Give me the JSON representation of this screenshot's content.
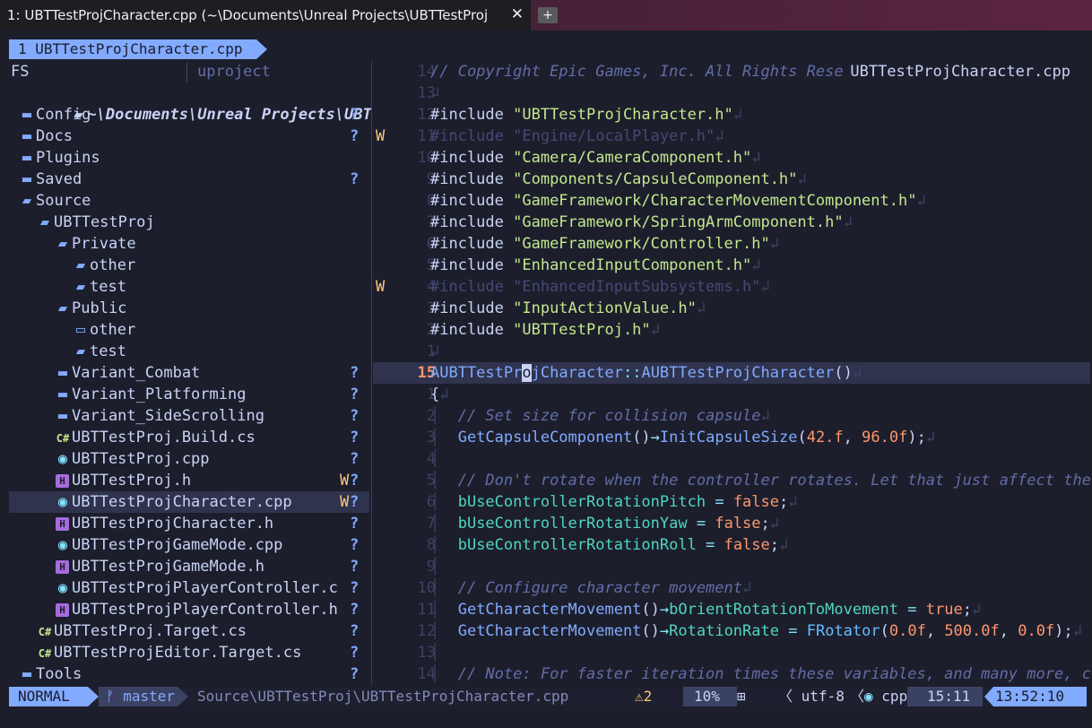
{
  "terminal": {
    "tab_title": "1: UBTTestProjCharacter.cpp (~\\Documents\\Unreal Projects\\UBTTestProj",
    "close_glyph": "✕",
    "new_tab_glyph": "+"
  },
  "bufferline": {
    "tab_label": "1 UBTTestProjCharacter.cpp"
  },
  "sidebar": {
    "header_left": "FS",
    "header_right": "uproject",
    "root": "~\\Documents\\Unreal Projects\\UBTTestPr",
    "items": [
      {
        "label": "Config",
        "icon": "folder-closed-icon",
        "glyph": "▬",
        "indent": 1,
        "git": "?",
        "warn": ""
      },
      {
        "label": "Docs",
        "icon": "folder-closed-icon",
        "glyph": "▬",
        "indent": 1,
        "git": "?",
        "warn": ""
      },
      {
        "label": "Plugins",
        "icon": "folder-closed-icon",
        "glyph": "▬",
        "indent": 1,
        "git": "",
        "warn": ""
      },
      {
        "label": "Saved",
        "icon": "folder-closed-icon",
        "glyph": "▬",
        "indent": 1,
        "git": "?",
        "warn": ""
      },
      {
        "label": "Source",
        "icon": "folder-open-icon",
        "glyph": "▰",
        "indent": 1,
        "git": "",
        "warn": ""
      },
      {
        "label": "UBTTestProj",
        "icon": "folder-open-icon",
        "glyph": "▰",
        "indent": 2,
        "git": "",
        "warn": ""
      },
      {
        "label": "Private",
        "icon": "folder-open-icon",
        "glyph": "▰",
        "indent": 3,
        "git": "",
        "warn": ""
      },
      {
        "label": "other",
        "icon": "folder-open-icon",
        "glyph": "▰",
        "indent": 4,
        "git": "",
        "warn": ""
      },
      {
        "label": "test",
        "icon": "folder-open-icon",
        "glyph": "▰",
        "indent": 4,
        "git": "",
        "warn": ""
      },
      {
        "label": "Public",
        "icon": "folder-open-icon",
        "glyph": "▰",
        "indent": 3,
        "git": "",
        "warn": ""
      },
      {
        "label": "other",
        "icon": "folder-empty-icon",
        "glyph": "▭",
        "indent": 4,
        "git": "",
        "warn": ""
      },
      {
        "label": "test",
        "icon": "folder-open-icon",
        "glyph": "▰",
        "indent": 4,
        "git": "",
        "warn": ""
      },
      {
        "label": "Variant_Combat",
        "icon": "folder-closed-icon",
        "glyph": "▬",
        "indent": 3,
        "git": "?",
        "warn": ""
      },
      {
        "label": "Variant_Platforming",
        "icon": "folder-closed-icon",
        "glyph": "▬",
        "indent": 3,
        "git": "?",
        "warn": ""
      },
      {
        "label": "Variant_SideScrolling",
        "icon": "folder-closed-icon",
        "glyph": "▬",
        "indent": 3,
        "git": "?",
        "warn": ""
      },
      {
        "label": "UBTTestProj.Build.cs",
        "icon": "csharp-file-icon",
        "glyph": "C#",
        "indent": 3,
        "git": "?",
        "warn": ""
      },
      {
        "label": "UBTTestProj.cpp",
        "icon": "cpp-file-icon",
        "glyph": "◉",
        "indent": 3,
        "git": "?",
        "warn": ""
      },
      {
        "label": "UBTTestProj.h",
        "icon": "header-file-icon",
        "glyph": "H",
        "indent": 3,
        "git": "?",
        "warn": "W"
      },
      {
        "label": "UBTTestProjCharacter.cpp",
        "icon": "cpp-file-icon",
        "glyph": "◉",
        "indent": 3,
        "git": "?",
        "warn": "W",
        "selected": true
      },
      {
        "label": "UBTTestProjCharacter.h",
        "icon": "header-file-icon",
        "glyph": "H",
        "indent": 3,
        "git": "?",
        "warn": ""
      },
      {
        "label": "UBTTestProjGameMode.cpp",
        "icon": "cpp-file-icon",
        "glyph": "◉",
        "indent": 3,
        "git": "?",
        "warn": ""
      },
      {
        "label": "UBTTestProjGameMode.h",
        "icon": "header-file-icon",
        "glyph": "H",
        "indent": 3,
        "git": "?",
        "warn": ""
      },
      {
        "label": "UBTTestProjPlayerController.c",
        "icon": "cpp-file-icon",
        "glyph": "◉",
        "indent": 3,
        "git": "?",
        "warn": ""
      },
      {
        "label": "UBTTestProjPlayerController.h",
        "icon": "header-file-icon",
        "glyph": "H",
        "indent": 3,
        "git": "?",
        "warn": ""
      },
      {
        "label": "UBTTestProj.Target.cs",
        "icon": "csharp-file-icon",
        "glyph": "C#",
        "indent": 2,
        "git": "?",
        "warn": ""
      },
      {
        "label": "UBTTestProjEditor.Target.cs",
        "icon": "csharp-file-icon",
        "glyph": "C#",
        "indent": 2,
        "git": "?",
        "warn": ""
      },
      {
        "label": "Tools",
        "icon": "folder-closed-icon",
        "glyph": "▬",
        "indent": 1,
        "git": "?",
        "warn": ""
      }
    ]
  },
  "editor": {
    "float_filename": "UBTTestProjCharacter.cpp",
    "lines": [
      {
        "num": "14",
        "warn": "",
        "tokens": [
          [
            "com",
            "// Copyright Epic Games, Inc. All Rights Reser"
          ]
        ]
      },
      {
        "num": "13",
        "warn": "",
        "tokens": [
          [
            "nl",
            "↲"
          ]
        ]
      },
      {
        "num": "12",
        "warn": "",
        "tokens": [
          [
            "inc",
            "#include "
          ],
          [
            "str",
            "\"UBTTestProjCharacter.h\""
          ],
          [
            "nl",
            "↲"
          ]
        ]
      },
      {
        "num": "11",
        "warn": "W",
        "tokens": [
          [
            "dim",
            "#include \"Engine/LocalPlayer.h\""
          ],
          [
            "nl",
            "↲"
          ]
        ]
      },
      {
        "num": "10",
        "warn": "",
        "tokens": [
          [
            "inc",
            "#include "
          ],
          [
            "str",
            "\"Camera/CameraComponent.h\""
          ],
          [
            "nl",
            "↲"
          ]
        ]
      },
      {
        "num": "9",
        "warn": "",
        "tokens": [
          [
            "inc",
            "#include "
          ],
          [
            "str",
            "\"Components/CapsuleComponent.h\""
          ],
          [
            "nl",
            "↲"
          ]
        ]
      },
      {
        "num": "8",
        "warn": "",
        "tokens": [
          [
            "inc",
            "#include "
          ],
          [
            "str",
            "\"GameFramework/CharacterMovementComponent.h\""
          ],
          [
            "nl",
            "↲"
          ]
        ]
      },
      {
        "num": "7",
        "warn": "",
        "tokens": [
          [
            "inc",
            "#include "
          ],
          [
            "str",
            "\"GameFramework/SpringArmComponent.h\""
          ],
          [
            "nl",
            "↲"
          ]
        ]
      },
      {
        "num": "6",
        "warn": "",
        "tokens": [
          [
            "inc",
            "#include "
          ],
          [
            "str",
            "\"GameFramework/Controller.h\""
          ],
          [
            "nl",
            "↲"
          ]
        ]
      },
      {
        "num": "5",
        "warn": "",
        "tokens": [
          [
            "inc",
            "#include "
          ],
          [
            "str",
            "\"EnhancedInputComponent.h\""
          ],
          [
            "nl",
            "↲"
          ]
        ]
      },
      {
        "num": "4",
        "warn": "W",
        "tokens": [
          [
            "dim",
            "#include \"EnhancedInputSubsystems.h\""
          ],
          [
            "nl",
            "↲"
          ]
        ]
      },
      {
        "num": "3",
        "warn": "",
        "tokens": [
          [
            "inc",
            "#include "
          ],
          [
            "str",
            "\"InputActionValue.h\""
          ],
          [
            "nl",
            "↲"
          ]
        ]
      },
      {
        "num": "2",
        "warn": "",
        "tokens": [
          [
            "inc",
            "#include "
          ],
          [
            "str",
            "\"UBTTestProj.h\""
          ],
          [
            "nl",
            "↲"
          ]
        ]
      },
      {
        "num": "1",
        "warn": "",
        "tokens": [
          [
            "nl",
            "↲"
          ]
        ]
      },
      {
        "num": "15",
        "warn": "",
        "current": true,
        "tokens": [
          [
            "cls",
            "AUBTTestPr"
          ],
          [
            "cursor",
            "o"
          ],
          [
            "cls",
            "jCharacter"
          ],
          [
            "op",
            "::"
          ],
          [
            "fn",
            "AUBTTestProjCharacter"
          ],
          [
            "inc",
            "()"
          ],
          [
            "nl",
            "↲"
          ]
        ]
      },
      {
        "num": "1",
        "warn": "",
        "tokens": [
          [
            "inc",
            "{"
          ],
          [
            "nl",
            "↲"
          ]
        ]
      },
      {
        "num": "2",
        "warn": "",
        "tokens": [
          [
            "indent",
            "│  "
          ],
          [
            "com",
            "// Set size for collision capsule"
          ],
          [
            "nl",
            "↲"
          ]
        ]
      },
      {
        "num": "3",
        "warn": "",
        "tokens": [
          [
            "indent",
            "│  "
          ],
          [
            "fn",
            "GetCapsuleComponent"
          ],
          [
            "inc",
            "()"
          ],
          [
            "op",
            "→"
          ],
          [
            "fn",
            "InitCapsuleSize"
          ],
          [
            "inc",
            "("
          ],
          [
            "num",
            "42.f"
          ],
          [
            "inc",
            ", "
          ],
          [
            "num",
            "96.0f"
          ],
          [
            "inc",
            ");"
          ],
          [
            "nl",
            "↲"
          ]
        ]
      },
      {
        "num": "4",
        "warn": "",
        "tokens": [
          [
            "indent",
            "│  "
          ],
          [
            "nl",
            ""
          ]
        ]
      },
      {
        "num": "5",
        "warn": "",
        "tokens": [
          [
            "indent",
            "│  "
          ],
          [
            "com",
            "// Don't rotate when the controller rotates. Let that just affect the"
          ]
        ]
      },
      {
        "num": "6",
        "warn": "",
        "tokens": [
          [
            "indent",
            "│  "
          ],
          [
            "var",
            "bUseControllerRotationPitch"
          ],
          [
            "inc",
            " "
          ],
          [
            "op",
            "="
          ],
          [
            "inc",
            " "
          ],
          [
            "bool",
            "false"
          ],
          [
            "inc",
            ";"
          ],
          [
            "nl",
            "↲"
          ]
        ]
      },
      {
        "num": "7",
        "warn": "",
        "tokens": [
          [
            "indent",
            "│  "
          ],
          [
            "var",
            "bUseControllerRotationYaw"
          ],
          [
            "inc",
            " "
          ],
          [
            "op",
            "="
          ],
          [
            "inc",
            " "
          ],
          [
            "bool",
            "false"
          ],
          [
            "inc",
            ";"
          ],
          [
            "nl",
            "↲"
          ]
        ]
      },
      {
        "num": "8",
        "warn": "",
        "tokens": [
          [
            "indent",
            "│  "
          ],
          [
            "var",
            "bUseControllerRotationRoll"
          ],
          [
            "inc",
            " "
          ],
          [
            "op",
            "="
          ],
          [
            "inc",
            " "
          ],
          [
            "bool",
            "false"
          ],
          [
            "inc",
            ";"
          ],
          [
            "nl",
            "↲"
          ]
        ]
      },
      {
        "num": "9",
        "warn": "",
        "tokens": [
          [
            "indent",
            "│  "
          ],
          [
            "nl",
            ""
          ]
        ]
      },
      {
        "num": "10",
        "warn": "",
        "tokens": [
          [
            "indent",
            "│  "
          ],
          [
            "com",
            "// Configure character movement"
          ],
          [
            "nl",
            "↲"
          ]
        ]
      },
      {
        "num": "11",
        "warn": "",
        "tokens": [
          [
            "indent",
            "│  "
          ],
          [
            "fn",
            "GetCharacterMovement"
          ],
          [
            "inc",
            "()"
          ],
          [
            "op",
            "→"
          ],
          [
            "var",
            "bOrientRotationToMovement"
          ],
          [
            "inc",
            " "
          ],
          [
            "op",
            "="
          ],
          [
            "inc",
            " "
          ],
          [
            "bool",
            "true"
          ],
          [
            "inc",
            ";"
          ],
          [
            "nl",
            "↲"
          ]
        ]
      },
      {
        "num": "12",
        "warn": "",
        "tokens": [
          [
            "indent",
            "│  "
          ],
          [
            "fn",
            "GetCharacterMovement"
          ],
          [
            "inc",
            "()"
          ],
          [
            "op",
            "→"
          ],
          [
            "var",
            "RotationRate"
          ],
          [
            "inc",
            " "
          ],
          [
            "op",
            "="
          ],
          [
            "inc",
            " "
          ],
          [
            "ty",
            "FRotator"
          ],
          [
            "inc",
            "("
          ],
          [
            "num",
            "0.0f"
          ],
          [
            "inc",
            ", "
          ],
          [
            "num",
            "500.0f"
          ],
          [
            "inc",
            ", "
          ],
          [
            "num",
            "0.0f"
          ],
          [
            "inc",
            ");"
          ],
          [
            "nl",
            "↲"
          ]
        ]
      },
      {
        "num": "13",
        "warn": "",
        "tokens": [
          [
            "indent",
            "│  "
          ],
          [
            "nl",
            ""
          ]
        ]
      },
      {
        "num": "14",
        "warn": "",
        "tokens": [
          [
            "indent",
            "│  "
          ],
          [
            "com",
            "// Note: For faster iteration times these variables, and many more, c"
          ]
        ]
      }
    ]
  },
  "statusline": {
    "mode": "NORMAL",
    "branch_glyph": "ᚠ",
    "branch": "master",
    "path": "Source\\UBTTestProj\\UBTTestProjCharacter.cpp",
    "warn_glyph": "⚠",
    "warnings": "2",
    "percent": "10%",
    "os_glyph": "⊞",
    "encoding": "utf-8",
    "filetype_glyph": "◉",
    "filetype": "cpp",
    "position": "15:11",
    "clock": "13:52:10",
    "separator": "〈"
  },
  "colors": {
    "accent": "#82aaff",
    "background": "#1c1e2c",
    "warning": "#ffc777",
    "string": "#c3e88d",
    "number": "#ff966c"
  }
}
